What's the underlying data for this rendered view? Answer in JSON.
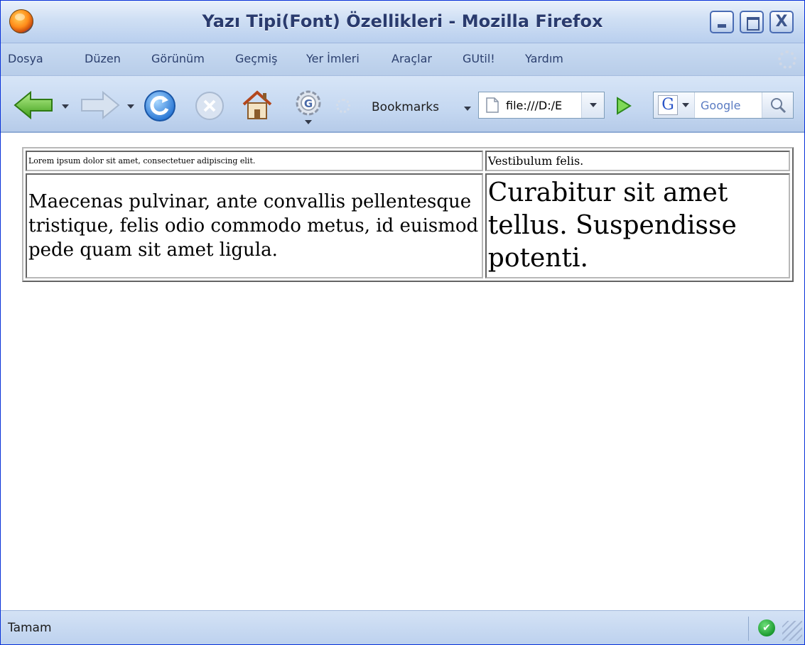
{
  "window": {
    "title": "Yazı Tipi(Font) Özellikleri - Mozilla Firefox",
    "minimize_icon": "minimize-icon",
    "maximize_icon": "maximize-icon",
    "close_label": "X"
  },
  "menu": {
    "items": [
      {
        "label": "Dosya"
      },
      {
        "label": "Düzen"
      },
      {
        "label": "Görünüm"
      },
      {
        "label": "Geçmiş"
      },
      {
        "label": "Yer İmleri"
      },
      {
        "label": "Araçlar"
      },
      {
        "label": "GUtil!"
      },
      {
        "label": "Yardım"
      }
    ]
  },
  "toolbar": {
    "icons": [
      "back-icon",
      "forward-icon",
      "reload-icon",
      "stop-icon",
      "home-icon",
      "google-toolbar-icon",
      "throbber-icon"
    ],
    "bookmarks_label": "Bookmarks",
    "url": "file:///D:/E",
    "go_icon": "go-icon"
  },
  "search": {
    "engine_letter": "G",
    "placeholder": "Google",
    "search_icon": "magnifier-icon"
  },
  "content": {
    "table": {
      "rows": [
        [
          "Lorem ipsum dolor sit amet, consectetuer adipiscing elit.",
          "Vestibulum felis."
        ],
        [
          "Maecenas pulvinar, ante convallis pellentesque tristique, felis odio commodo metus, id euismod pede quam sit amet ligula.",
          "Curabitur sit amet tellus. Suspendisse potenti."
        ]
      ]
    }
  },
  "status": {
    "text": "Tamam",
    "secure_icon": "check-shield-icon"
  },
  "colors": {
    "titlebar": "#cfdff4",
    "menubar": "#c9dbf2",
    "toolbar": "#c5d8f1",
    "accent": "#2b3f6e"
  }
}
